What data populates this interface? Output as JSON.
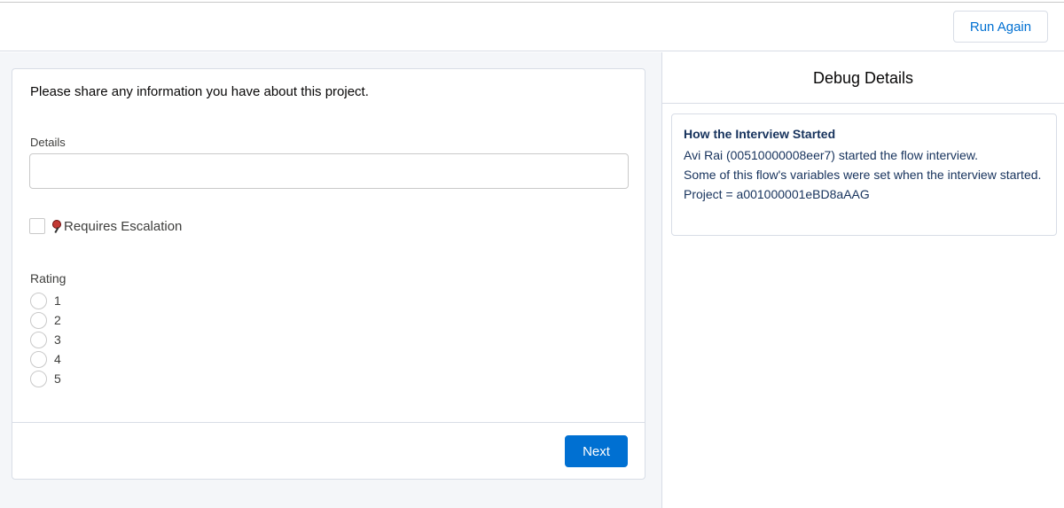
{
  "header": {
    "run_again_label": "Run Again"
  },
  "screen": {
    "prompt": "Please share any information you have about this project.",
    "details_label": "Details",
    "details_value": "",
    "checkbox_label": "Requires Escalation",
    "checkbox_checked": false,
    "rating_label": "Rating",
    "rating_options": [
      "1",
      "2",
      "3",
      "4",
      "5"
    ],
    "next_label": "Next"
  },
  "debug": {
    "title": "Debug Details",
    "heading": "How the Interview Started",
    "lines": [
      "Avi Rai (00510000008eer7) started the flow interview.",
      "Some of this flow's variables were set when the interview started.",
      "Project = a001000001eBD8aAAG"
    ]
  },
  "colors": {
    "accent": "#0070d2",
    "border": "#d8dde6",
    "page_bg": "#f4f6f9"
  },
  "icons": {
    "escalation": "pin-icon"
  }
}
